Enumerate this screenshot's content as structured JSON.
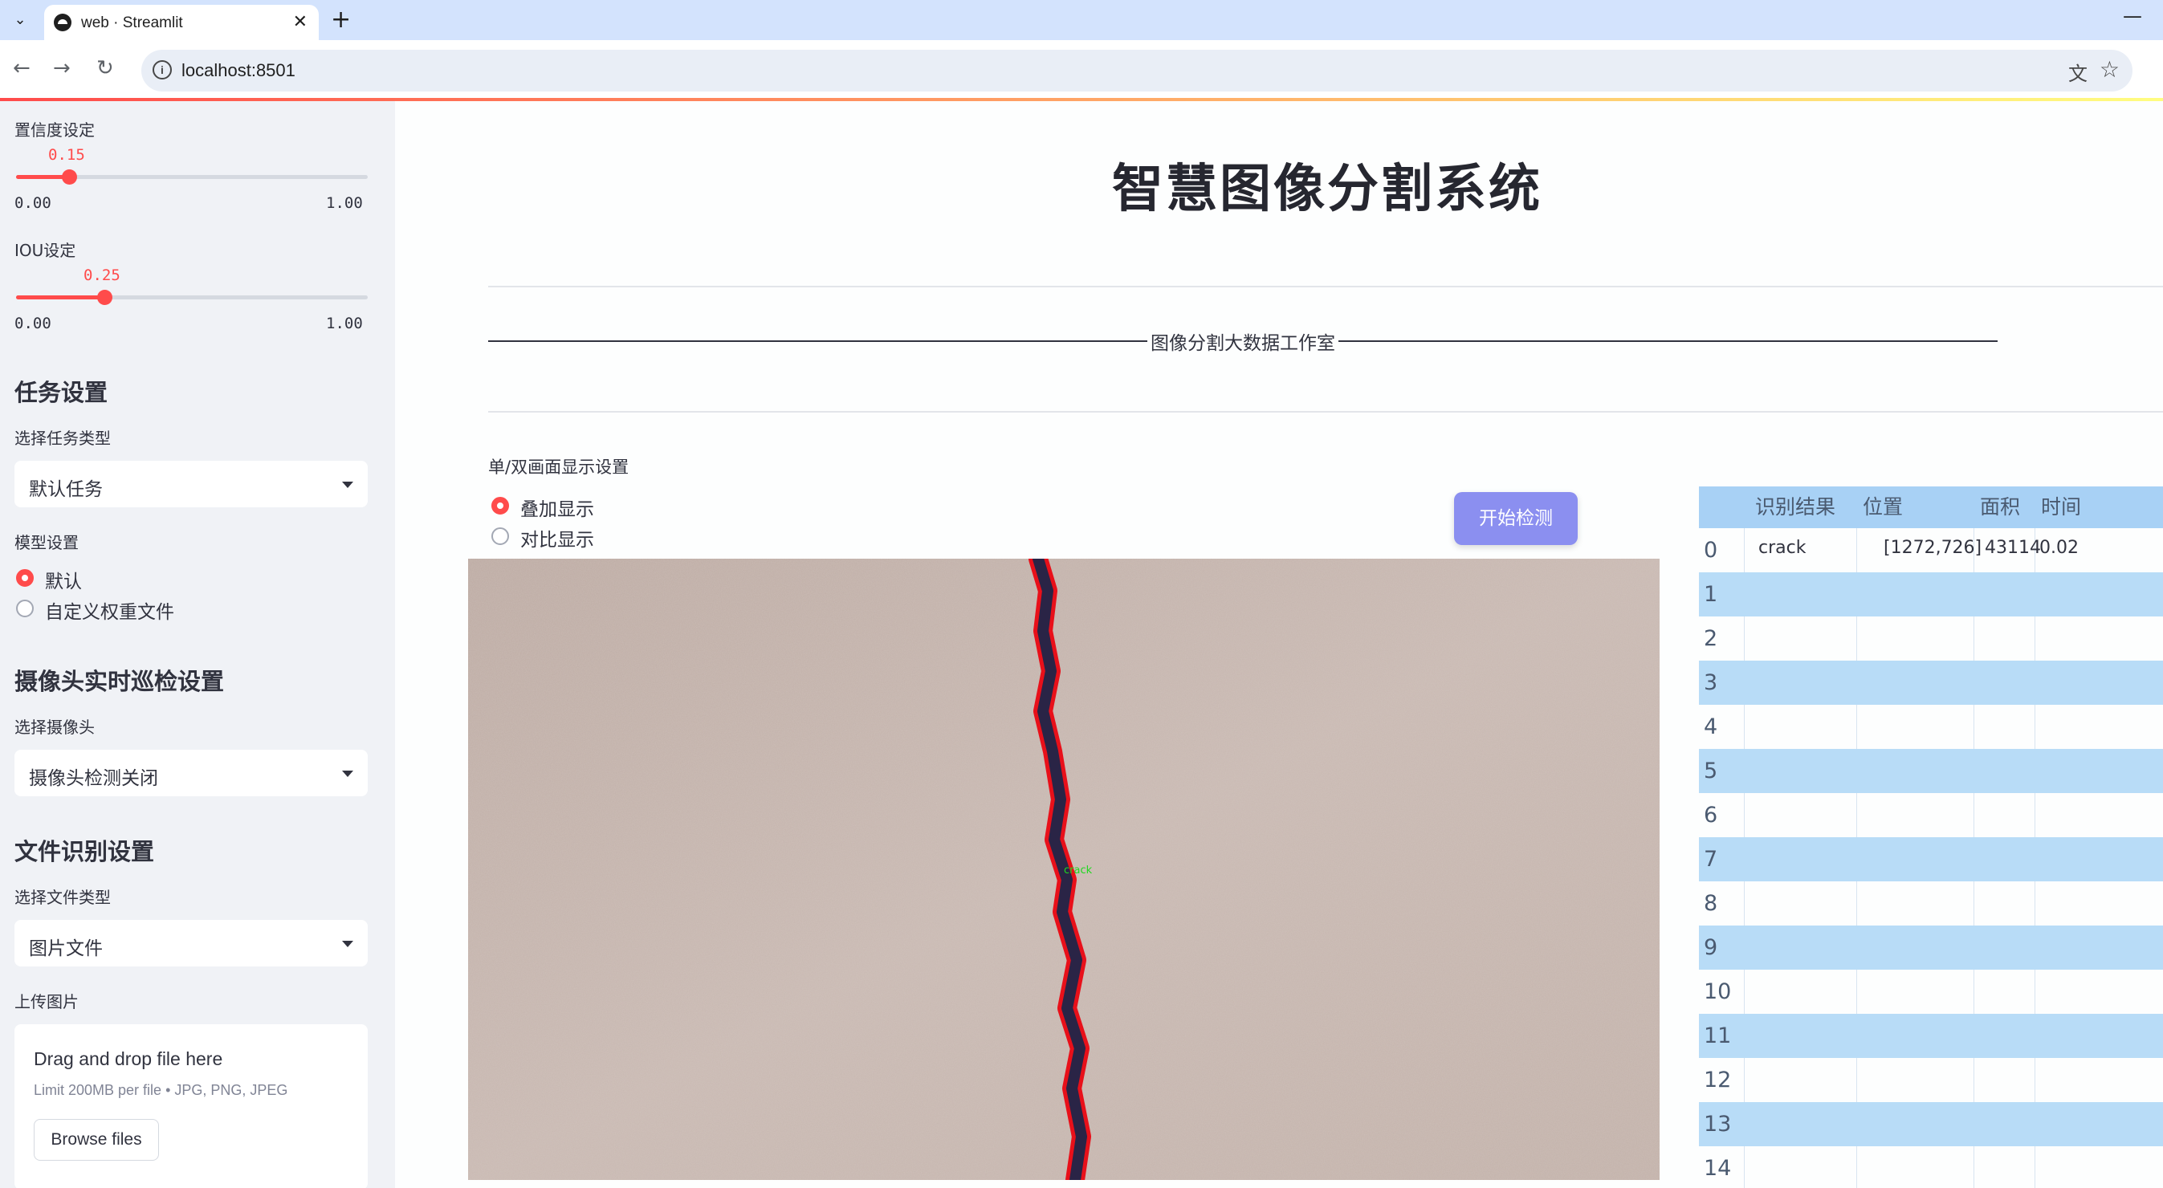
{
  "browser": {
    "tab_title": "web · Streamlit",
    "url": "localhost:8501"
  },
  "sidebar": {
    "confidence": {
      "label": "置信度设定",
      "value": "0.15",
      "min": "0.00",
      "max": "1.00",
      "fraction": 0.15
    },
    "iou": {
      "label": "IOU设定",
      "value": "0.25",
      "min": "0.00",
      "max": "1.00",
      "fraction": 0.25
    },
    "task_section": {
      "heading": "任务设置",
      "select_label": "选择任务类型",
      "selected": "默认任务"
    },
    "model_section": {
      "label": "模型设置",
      "options": [
        "默认",
        "自定义权重文件"
      ],
      "selected_index": 0
    },
    "camera_section": {
      "heading": "摄像头实时巡检设置",
      "select_label": "选择摄像头",
      "selected": "摄像头检测关闭"
    },
    "file_section": {
      "heading": "文件识别设置",
      "select_label": "选择文件类型",
      "selected": "图片文件"
    },
    "upload": {
      "label": "上传图片",
      "title": "Drag and drop file here",
      "limit": "Limit 200MB per file • JPG, PNG, JPEG",
      "button": "Browse files"
    }
  },
  "main": {
    "title": "智慧图像分割系统",
    "banner": "图像分割大数据工作室",
    "display_setting_label": "单/双画面显示设置",
    "display_options": [
      "叠加显示",
      "对比显示"
    ],
    "display_selected_index": 0,
    "start_button": "开始检测",
    "detection_tag": "crack"
  },
  "results_table": {
    "columns": [
      "识别结果",
      "位置",
      "面积",
      "时间"
    ],
    "rows": [
      {
        "index": "0",
        "result": "crack",
        "position": "[1272,726]",
        "area": "43114",
        "time": "0.02"
      },
      {
        "index": "1"
      },
      {
        "index": "2"
      },
      {
        "index": "3"
      },
      {
        "index": "4"
      },
      {
        "index": "5"
      },
      {
        "index": "6"
      },
      {
        "index": "7"
      },
      {
        "index": "8"
      },
      {
        "index": "9"
      },
      {
        "index": "10"
      },
      {
        "index": "11"
      },
      {
        "index": "12"
      },
      {
        "index": "13"
      },
      {
        "index": "14"
      }
    ]
  },
  "colors": {
    "accent": "#ff4b4b",
    "sidebar_bg": "#f0f2f6",
    "button": "#8b8ff0",
    "table_header": "#a8d1f5",
    "table_alt_row": "#b8dcf7",
    "wall": "#c6b5ad",
    "mask_outline": "#e8101a"
  },
  "icons": {
    "tab_menu": "chevron-down-icon",
    "back": "back-arrow-icon",
    "forward": "forward-arrow-icon",
    "reload": "reload-icon",
    "site_info": "info-icon",
    "translate": "translate-icon",
    "bookmark": "star-icon",
    "select_caret": "caret-down-icon"
  }
}
